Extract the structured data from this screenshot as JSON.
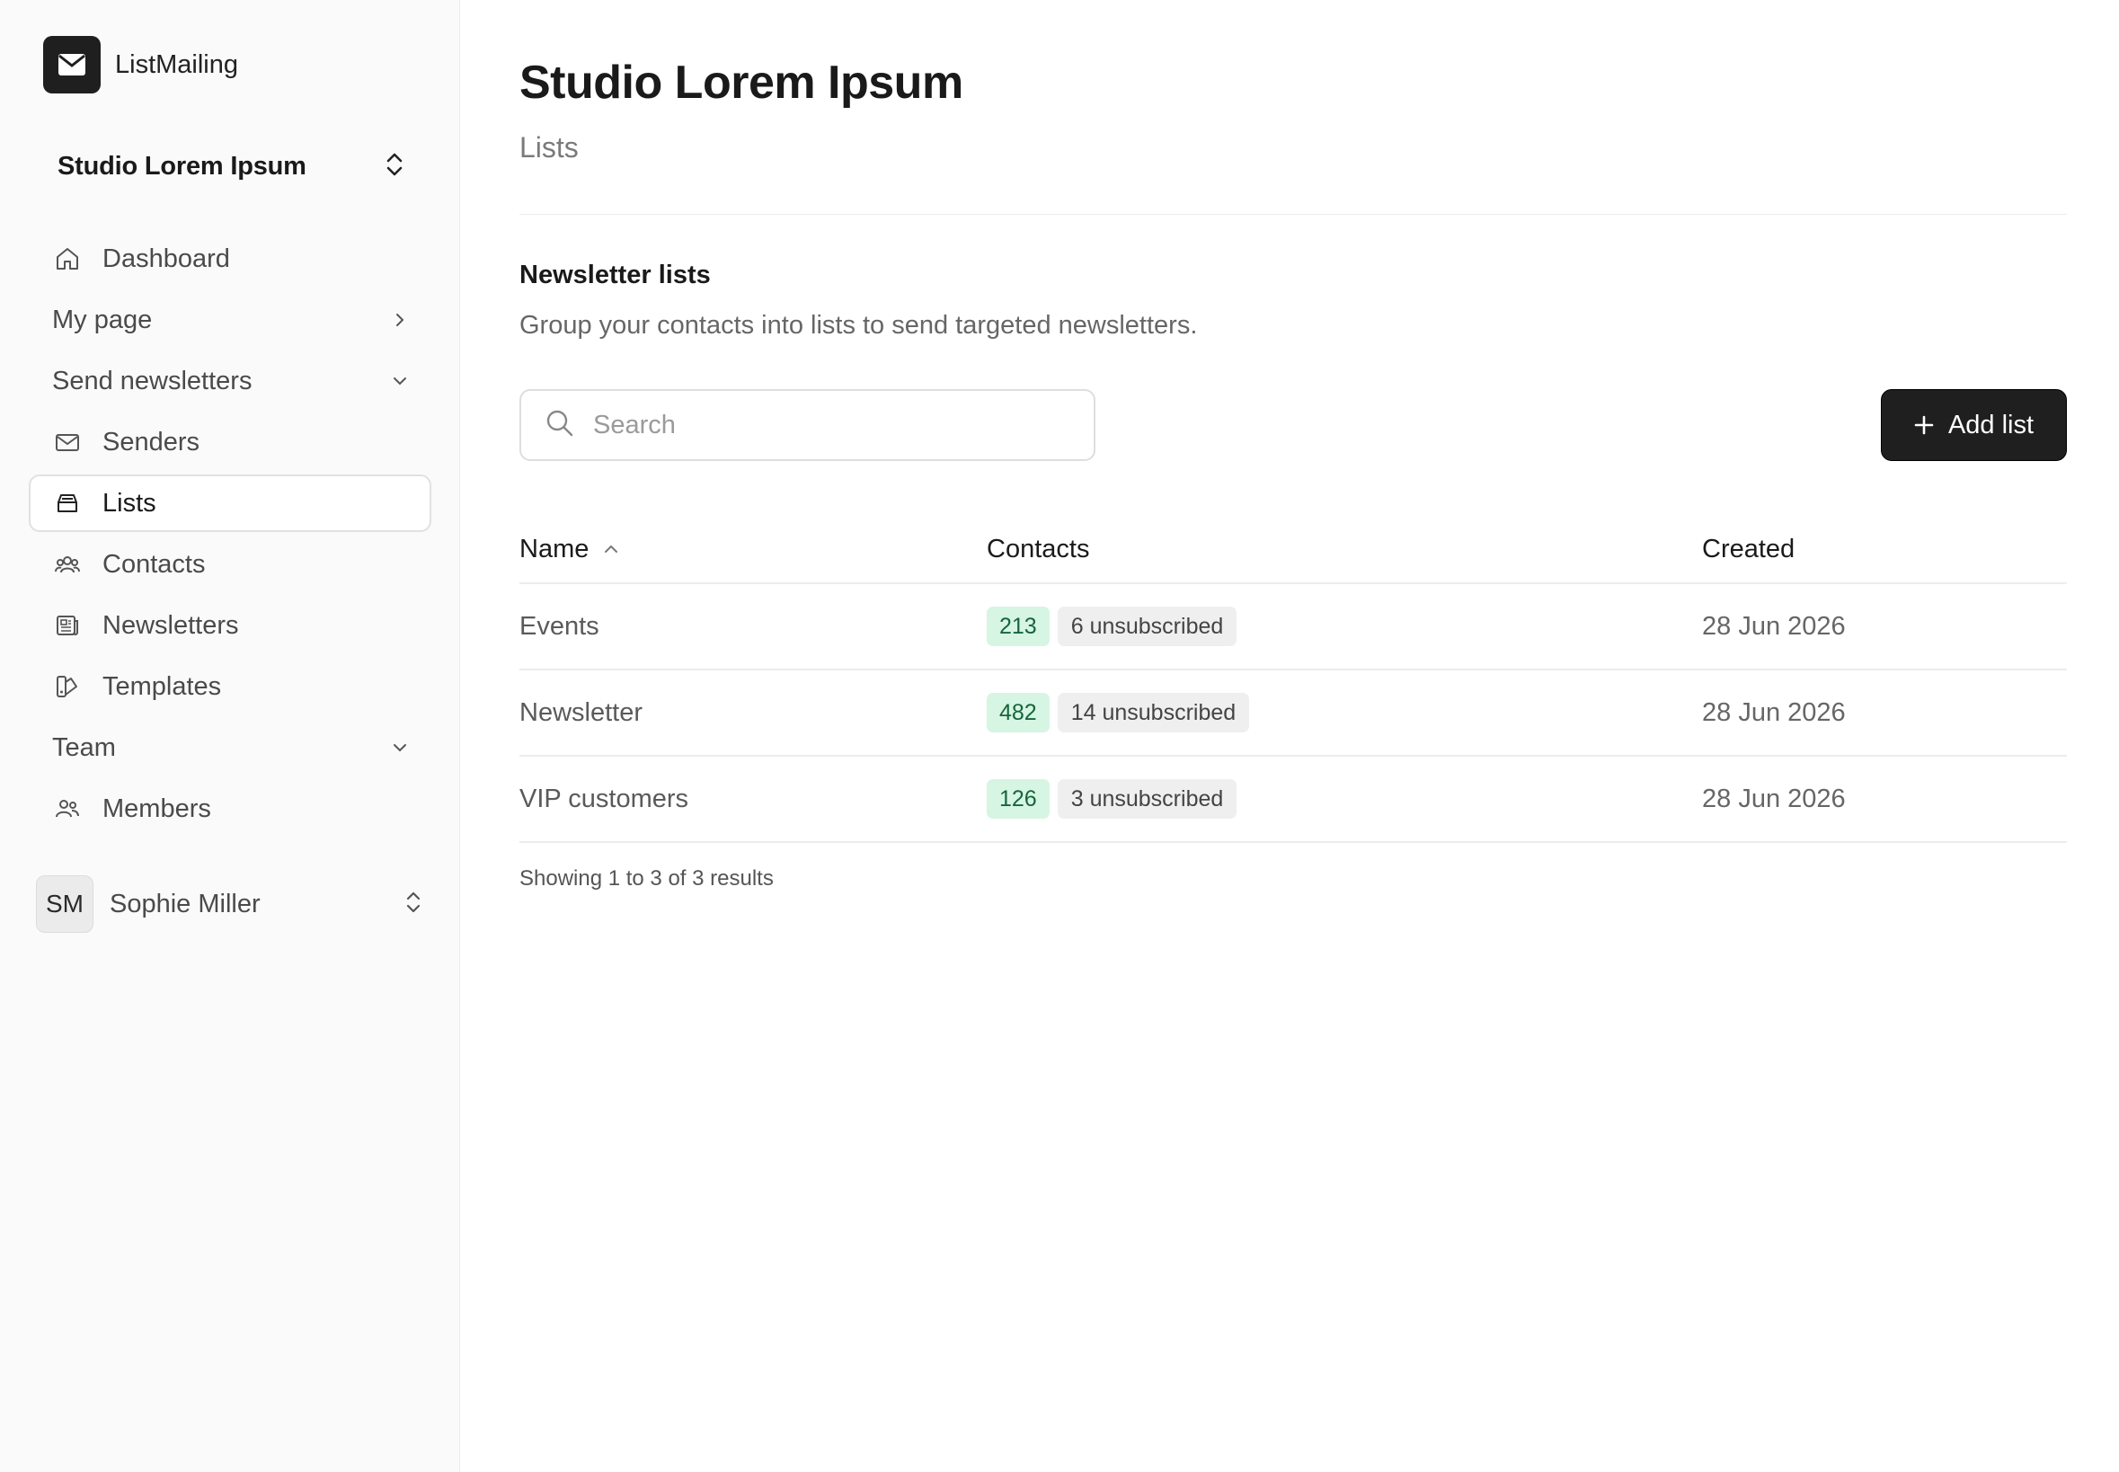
{
  "brand": {
    "name": "ListMailing"
  },
  "org": {
    "name": "Studio Lorem Ipsum"
  },
  "nav": {
    "dashboard": "Dashboard",
    "my_page": "My page",
    "send_newsletters": "Send newsletters",
    "senders": "Senders",
    "lists": "Lists",
    "contacts": "Contacts",
    "newsletters": "Newsletters",
    "templates": "Templates",
    "team": "Team",
    "members": "Members"
  },
  "user": {
    "initials": "SM",
    "name": "Sophie Miller"
  },
  "header": {
    "title": "Studio Lorem Ipsum",
    "subtitle": "Lists"
  },
  "section": {
    "title": "Newsletter lists",
    "description": "Group your contacts into lists to send targeted newsletters."
  },
  "search": {
    "placeholder": "Search",
    "value": ""
  },
  "toolbar": {
    "add_label": "Add list"
  },
  "table": {
    "headers": {
      "name": "Name",
      "contacts": "Contacts",
      "created": "Created"
    },
    "rows": [
      {
        "name": "Events",
        "count": "213",
        "unsubscribed": "6 unsubscribed",
        "created": "28 Jun 2026"
      },
      {
        "name": "Newsletter",
        "count": "482",
        "unsubscribed": "14 unsubscribed",
        "created": "28 Jun 2026"
      },
      {
        "name": "VIP customers",
        "count": "126",
        "unsubscribed": "3 unsubscribed",
        "created": "28 Jun 2026"
      }
    ]
  },
  "footer": {
    "results": "Showing 1 to 3 of 3 results"
  },
  "colors": {
    "accent_dark": "#1f1f1f",
    "count_badge_bg": "#d6f5e3",
    "count_badge_text": "#17653c"
  }
}
